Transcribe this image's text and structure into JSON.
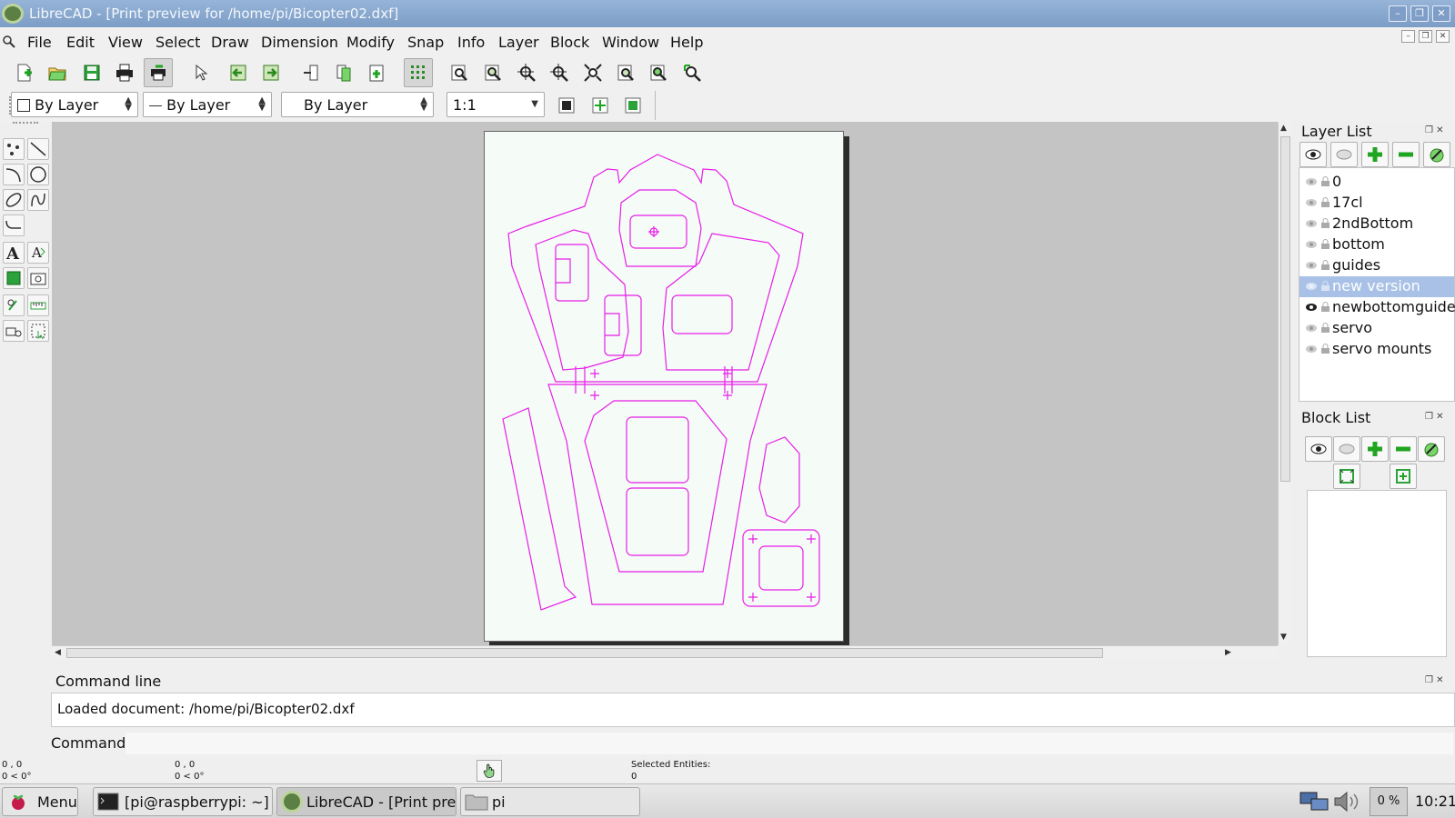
{
  "window": {
    "title": "LibreCAD - [Print preview for /home/pi/Bicopter02.dxf]"
  },
  "menu": [
    "File",
    "Edit",
    "View",
    "Select",
    "Draw",
    "Dimension",
    "Modify",
    "Snap",
    "Info",
    "Layer",
    "Block",
    "Window",
    "Help"
  ],
  "toolbar2": {
    "color": "By Layer",
    "linetype": "By Layer",
    "linewidth": "By Layer",
    "scale": "1:1"
  },
  "layer_list": {
    "title": "Layer List",
    "layers": [
      "0",
      "17cl",
      "2ndBottom",
      "bottom",
      "guides",
      "new version",
      "newbottomguides",
      "servo",
      "servo mounts"
    ],
    "selected": "new version"
  },
  "block_list": {
    "title": "Block List"
  },
  "command_line": {
    "title": "Command line",
    "history": "Loaded document: /home/pi/Bicopter02.dxf",
    "prompt": "Command:"
  },
  "status": {
    "abs_coord": "0 , 0",
    "abs_polar": "0 < 0°",
    "rel_coord": "0 , 0",
    "rel_polar": "0 < 0°",
    "selected_label": "Selected Entities:",
    "selected_count": "0"
  },
  "taskbar": {
    "menu": "Menu",
    "tasks": [
      "[pi@raspberrypi: ~]",
      "LibreCAD - [Print previ...",
      "pi"
    ],
    "cpu": "0 %",
    "clock": "10:21"
  },
  "colors": {
    "entity": "#e81ee8",
    "paper": "#f5fbf7",
    "canvas": "#c4c4c4",
    "titlebar": "#8aa9d0",
    "selection": "#a9c1e6"
  }
}
